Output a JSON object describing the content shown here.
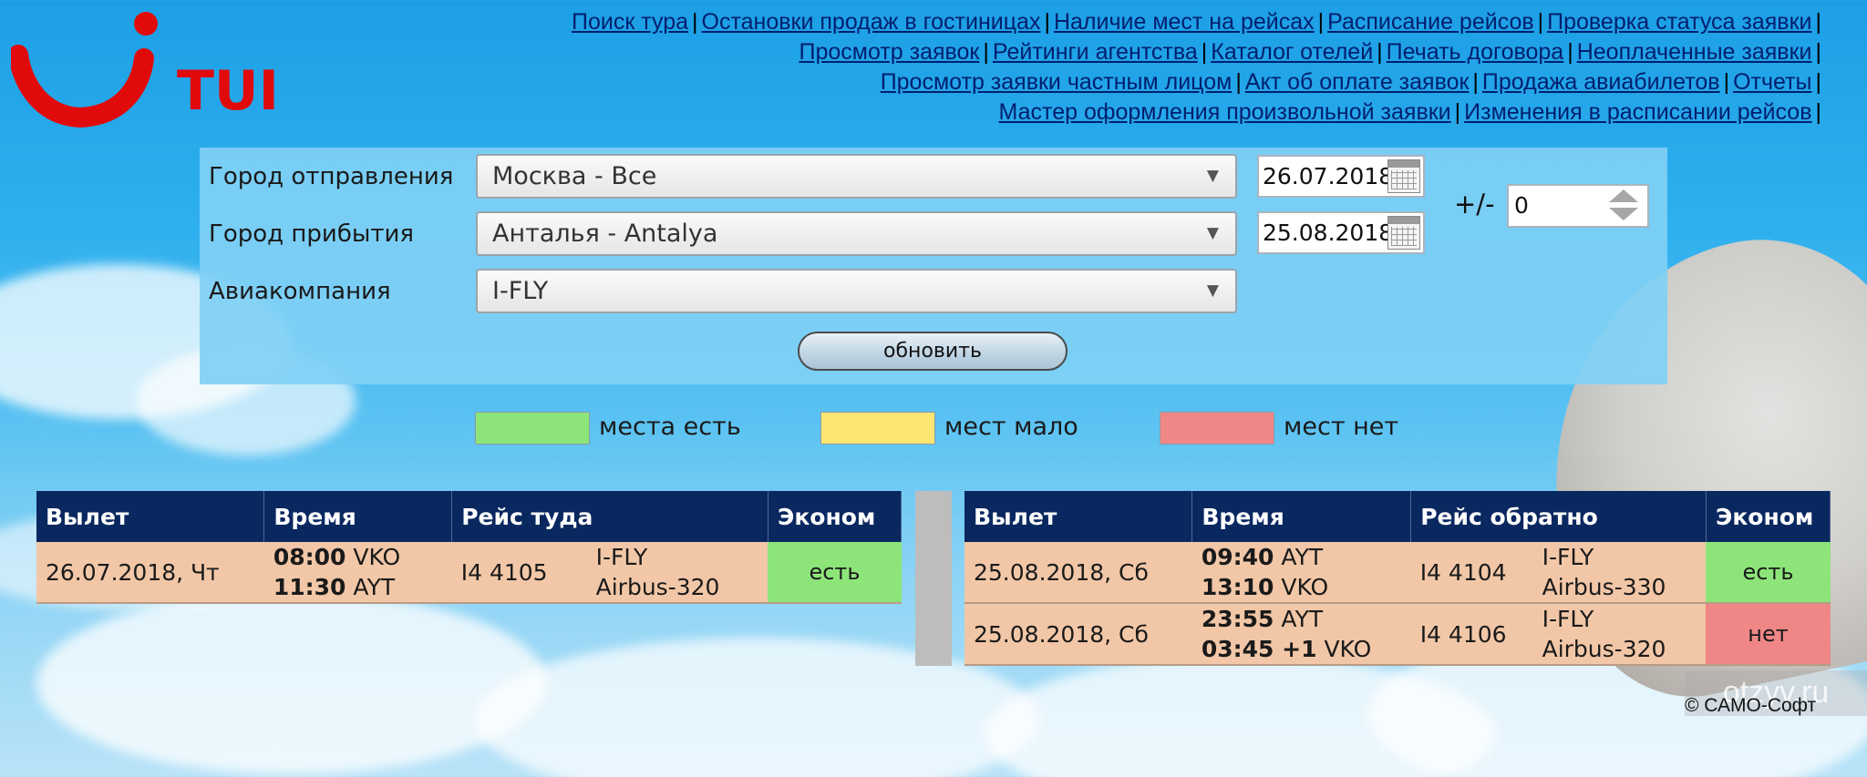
{
  "logo": {
    "brand": "TUI",
    "brand_color": "#e10a0a"
  },
  "nav": {
    "lines": [
      [
        "Поиск тура",
        "Остановки продаж в гостиницах",
        "Наличие мест на рейсах",
        "Расписание рейсов",
        "Проверка статуса заявки"
      ],
      [
        "Просмотр заявок",
        "Рейтинги агентства",
        "Каталог отелей",
        "Печать договора",
        "Неоплаченные заявки"
      ],
      [
        "Просмотр заявки частным лицом",
        "Акт об оплате заявок",
        "Продажа авиабилетов",
        "Отчеты"
      ],
      [
        "Мастер оформления произвольной заявки",
        "Изменения в расписании рейсов"
      ]
    ],
    "separator": "|"
  },
  "form": {
    "departure_label": "Город отправления",
    "departure_value": "Москва - Все",
    "arrival_label": "Город прибытия",
    "arrival_value": "Анталья - Antalya",
    "airline_label": "Авиакомпания",
    "airline_value": "I-FLY",
    "date_from": "26.07.2018",
    "date_to": "25.08.2018",
    "plusminus_label": "+/-",
    "plusminus_value": "0",
    "refresh_label": "обновить"
  },
  "legend": [
    {
      "label": "места есть",
      "color": "#8de57a"
    },
    {
      "label": "мест мало",
      "color": "#fde574"
    },
    {
      "label": "мест нет",
      "color": "#f08787"
    }
  ],
  "outbound": {
    "headers": [
      "Вылет",
      "Время",
      "Рейс туда",
      "Эконом"
    ],
    "rows": [
      {
        "date": "26.07.2018, Чт",
        "dep_time": "08:00",
        "dep_airport": "VKO",
        "arr_time": "11:30",
        "arr_airport": "AYT",
        "flight": "I4 4105",
        "airline": "I-FLY",
        "aircraft": "Airbus-320",
        "economy": "есть",
        "status": "yes"
      }
    ]
  },
  "return": {
    "headers": [
      "Вылет",
      "Время",
      "Рейс обратно",
      "Эконом"
    ],
    "rows": [
      {
        "date": "25.08.2018, Сб",
        "dep_time": "09:40",
        "dep_airport": "AYT",
        "arr_time": "13:10",
        "arr_airport": "VKO",
        "flight": "I4 4104",
        "airline": "I-FLY",
        "aircraft": "Airbus-330",
        "economy": "есть",
        "status": "yes"
      },
      {
        "date": "25.08.2018, Сб",
        "dep_time": "23:55",
        "dep_airport": "AYT",
        "arr_time": "03:45 +1",
        "arr_airport": "VKO",
        "flight": "I4 4106",
        "airline": "I-FLY",
        "aircraft": "Airbus-320",
        "economy": "нет",
        "status": "no"
      }
    ]
  },
  "footer": {
    "copyright": "© САМО-Софт",
    "watermark": "otzyv.ru"
  }
}
